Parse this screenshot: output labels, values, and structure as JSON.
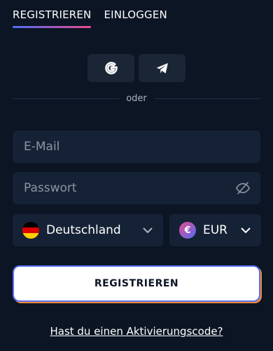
{
  "tabs": [
    {
      "label": "REGISTRIEREN",
      "active": true
    },
    {
      "label": "EINLOGGEN",
      "active": false
    }
  ],
  "social": [
    {
      "icon": "google-icon"
    },
    {
      "icon": "telegram-icon"
    }
  ],
  "divider": {
    "label": "oder"
  },
  "email": {
    "placeholder": "E-Mail",
    "value": ""
  },
  "password": {
    "placeholder": "Passwort",
    "value": "",
    "icon": "eye-off-icon"
  },
  "country": {
    "value": "Deutschland",
    "icon": "germany-flag-icon"
  },
  "currency": {
    "value": "EUR",
    "symbol": "€",
    "icon": "euro-icon"
  },
  "register_button": {
    "label": "REGISTRIEREN"
  },
  "activation_link": {
    "label": "Hast du einen Aktivierungscode?"
  },
  "colors": {
    "background": "#0b1524",
    "field": "#152236",
    "social_button": "#1a2535",
    "accent_blue": "#4f6df5",
    "accent_pink": "#e94a8f",
    "accent_orange": "#f08a3a"
  }
}
